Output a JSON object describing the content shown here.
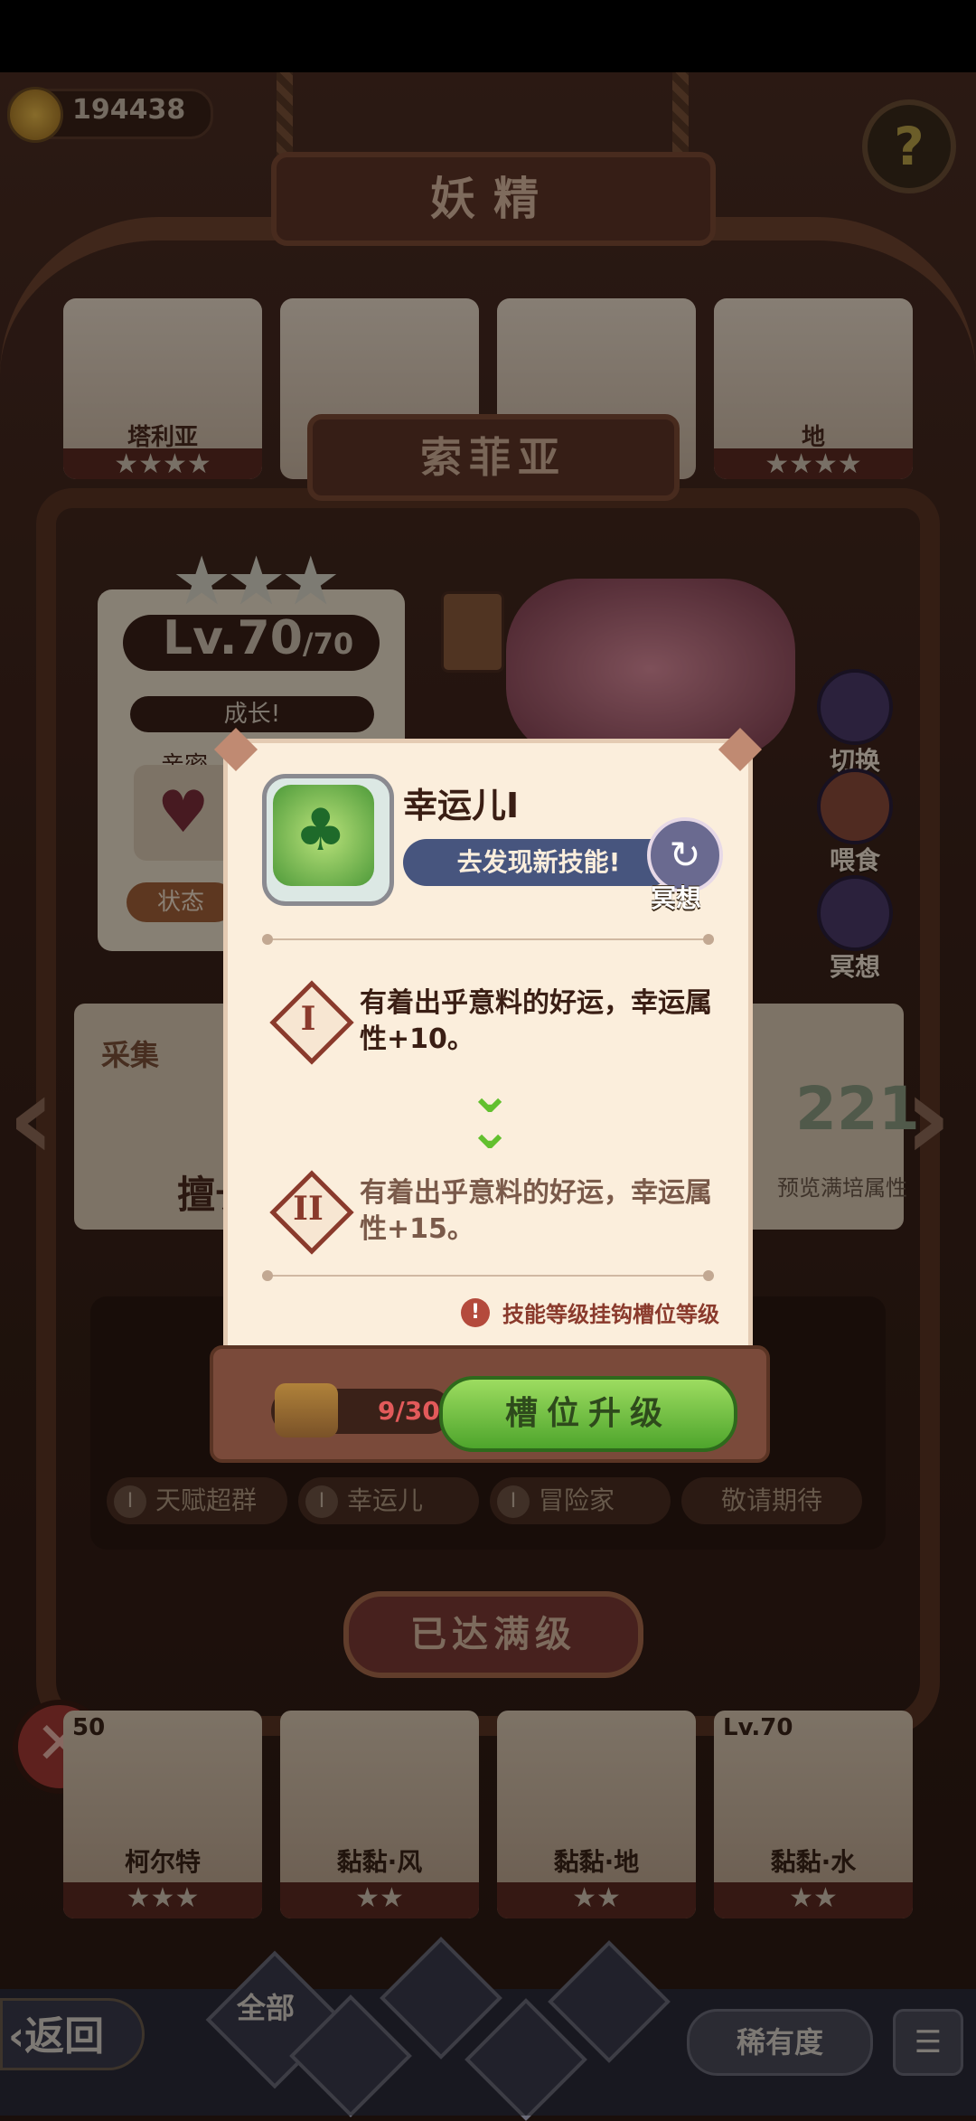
{
  "top": {
    "currency": "194438",
    "help_icon": "?"
  },
  "title": "妖精",
  "fairy_row": [
    {
      "name": "塔利亚",
      "stars": "★★★★"
    },
    {
      "name": "",
      "stars": ""
    },
    {
      "name": "",
      "stars": ""
    },
    {
      "name": "地",
      "stars": "★★★★"
    }
  ],
  "current_fairy": {
    "name": "索菲亚",
    "stars": "★★★",
    "level": "Lv.70",
    "level_max": "/70",
    "grow_label": "成长!",
    "intimacy_label": "亲密",
    "state_label": "状态"
  },
  "side_buttons": [
    {
      "label": "切换",
      "icon": "switch-icon"
    },
    {
      "label": "喂食",
      "icon": "feed-icon"
    },
    {
      "label": "冥想",
      "icon": "meditate-icon"
    }
  ],
  "collect_label": "采集",
  "level_text": "擅长",
  "value_panel": {
    "value": "221",
    "caption": "预览满培属性"
  },
  "slots": [
    {
      "numeral": "I",
      "label": "天赋超群"
    },
    {
      "numeral": "I",
      "label": "幸运儿"
    },
    {
      "numeral": "I",
      "label": "冒险家"
    },
    {
      "numeral": "",
      "label": "敬请期待"
    }
  ],
  "maxed_label": "已达满级",
  "close_icon": "✕",
  "roster": [
    {
      "level": "50",
      "name": "柯尔特",
      "stars": "★★★"
    },
    {
      "level": "",
      "name": "黏黏·风",
      "stars": "★★"
    },
    {
      "level": "",
      "name": "黏黏·地",
      "stars": "★★"
    },
    {
      "level": "Lv.70",
      "name": "黏黏·水",
      "stars": "★★"
    }
  ],
  "bottom_bar": {
    "back_label": "返回",
    "all_label": "全部",
    "rarity_label": "稀有度"
  },
  "popup": {
    "skill_name": "幸运儿I",
    "discover_label": "去发现新技能!",
    "meditate_label": "冥想",
    "levels": [
      {
        "numeral": "I",
        "text": "有着出乎意料的好运，幸运属性+10。",
        "color": "#3a1e14"
      },
      {
        "numeral": "II",
        "text": "有着出乎意料的好运，幸运属性+15。",
        "color": "#7a5a4a"
      }
    ],
    "warning": "技能等级挂钩槽位等级",
    "material_count": "9/30",
    "upgrade_label": "槽位升级"
  }
}
